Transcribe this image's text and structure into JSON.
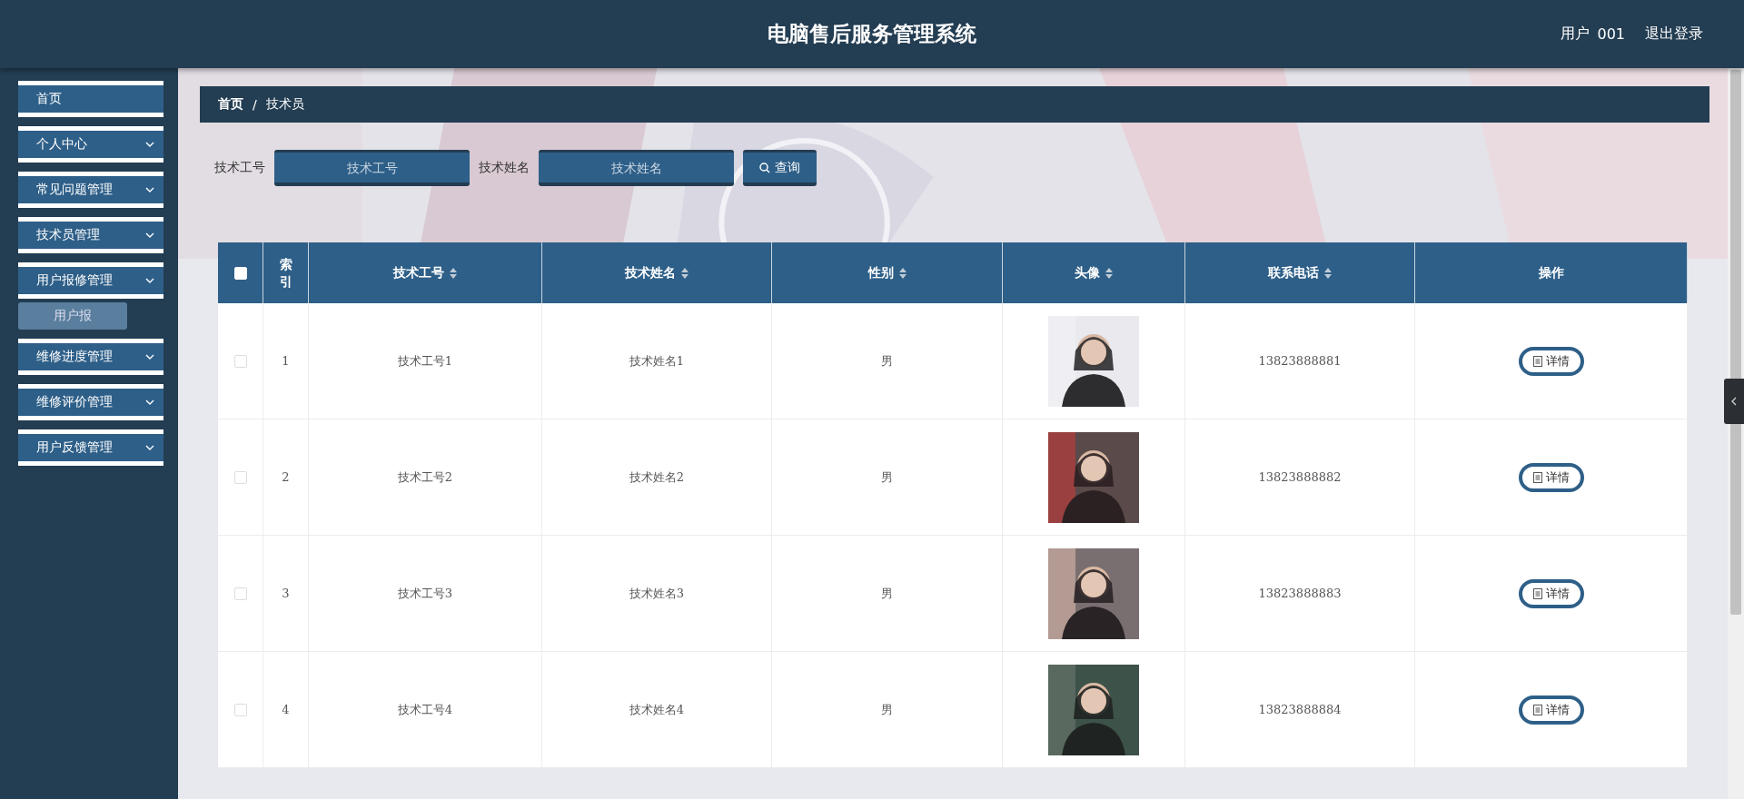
{
  "header": {
    "title": "电脑售后服务管理系统",
    "user_label": "用户",
    "user_name": "001",
    "logout": "退出登录"
  },
  "sidebar": {
    "items": [
      {
        "label": "首页",
        "expandable": false,
        "expanded": false
      },
      {
        "label": "个人中心",
        "expandable": true,
        "expanded": false
      },
      {
        "label": "常见问题管理",
        "expandable": true,
        "expanded": false
      },
      {
        "label": "技术员管理",
        "expandable": true,
        "expanded": false
      },
      {
        "label": "用户报修管理",
        "expandable": true,
        "expanded": true,
        "children": [
          {
            "label": "用户报",
            "selected": true
          }
        ]
      },
      {
        "label": "维修进度管理",
        "expandable": true,
        "expanded": false
      },
      {
        "label": "维修评价管理",
        "expandable": true,
        "expanded": false
      },
      {
        "label": "用户反馈管理",
        "expandable": true,
        "expanded": false
      }
    ]
  },
  "breadcrumb": [
    "首页",
    "/",
    "技术员"
  ],
  "search": {
    "fields": [
      {
        "label": "技术工号",
        "placeholder": "技术工号"
      },
      {
        "label": "技术姓名",
        "placeholder": "技术姓名"
      }
    ],
    "button": "查询"
  },
  "table": {
    "select_all_checked": false,
    "columns": [
      {
        "label": "索引",
        "sortable": false
      },
      {
        "label": "技术工号",
        "sortable": true
      },
      {
        "label": "技术姓名",
        "sortable": true
      },
      {
        "label": "性别",
        "sortable": true
      },
      {
        "label": "头像",
        "sortable": true
      },
      {
        "label": "联系电话",
        "sortable": true
      },
      {
        "label": "操作",
        "sortable": false
      }
    ],
    "rows": [
      {
        "checked": false,
        "index": "1",
        "id": "技术工号1",
        "name": "技术姓名1",
        "gender": "男",
        "phone": "13823888881",
        "action": "详情"
      },
      {
        "checked": false,
        "index": "2",
        "id": "技术工号2",
        "name": "技术姓名2",
        "gender": "男",
        "phone": "13823888882",
        "action": "详情"
      },
      {
        "checked": false,
        "index": "3",
        "id": "技术工号3",
        "name": "技术姓名3",
        "gender": "男",
        "phone": "13823888883",
        "action": "详情"
      },
      {
        "checked": false,
        "index": "4",
        "id": "技术工号4",
        "name": "技术姓名4",
        "gender": "男",
        "phone": "13823888884",
        "action": "详情"
      }
    ]
  }
}
